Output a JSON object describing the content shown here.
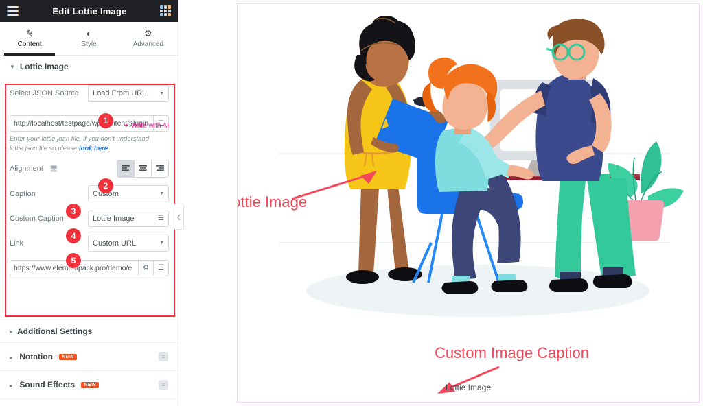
{
  "panel": {
    "header": {
      "title": "Edit Lottie Image",
      "menu_icon": "hamburger-icon",
      "apps_icon": "grid-apps-icon"
    },
    "tabs": [
      {
        "label": "Content",
        "icon": "pencil-icon",
        "active": true
      },
      {
        "label": "Style",
        "icon": "contrast-icon",
        "active": false
      },
      {
        "label": "Advanced",
        "icon": "gear-icon",
        "active": false
      }
    ],
    "sections": {
      "lottie_image": "Lottie Image",
      "additional_settings": "Additional Settings",
      "notation": "Notation",
      "sound_effects": "Sound Effects",
      "new_tag": "NEW",
      "pro_icon": "pro-badge-icon"
    },
    "fields": {
      "json_source": {
        "label": "Select JSON Source",
        "value": "Load From URL",
        "badge": "1"
      },
      "write_with_ai": "Write with AI",
      "url": {
        "value": "http://localhost/testpage/wp-content/plugin",
        "dynamic_icon": "dynamic-tags-icon"
      },
      "helper_text_1": "Enter your lottie joan file, if you don't understand",
      "helper_text_2": "lottie json file so please",
      "helper_link": "look here",
      "alignment": {
        "label": "Alignment",
        "device_icon": "desktop-icon",
        "badge": "2",
        "options": [
          "align-left-icon",
          "align-center-icon",
          "align-right-icon"
        ],
        "selected": "align-left-icon"
      },
      "caption": {
        "label": "Caption",
        "value": "Custom",
        "badge": "3"
      },
      "custom_caption": {
        "label": "Custom Caption",
        "value": "Lottie Image",
        "badge": "4",
        "dynamic_icon": "dynamic-tags-icon"
      },
      "link": {
        "label": "Link",
        "value": "Custom URL",
        "badge": "5"
      },
      "link_url": {
        "value": "https://www.elementpack.pro/demo/e",
        "settings_icon": "gear-icon",
        "dynamic_icon": "dynamic-tags-icon"
      }
    },
    "collapse_icon": "chevron-left-icon"
  },
  "canvas": {
    "annotation_lottie": "Lottie Image",
    "annotation_caption": "Custom Image Caption",
    "image_caption": "Lottie Image",
    "illustration_name": "office-team-illustration"
  },
  "colors": {
    "accent_red": "#f0313c",
    "annotation_red": "#f4485a",
    "ai_magenta": "#e5158f",
    "canvas_border": "#f2d0fb",
    "panel_header": "#1f2124",
    "new_tag": "#f4511e"
  }
}
